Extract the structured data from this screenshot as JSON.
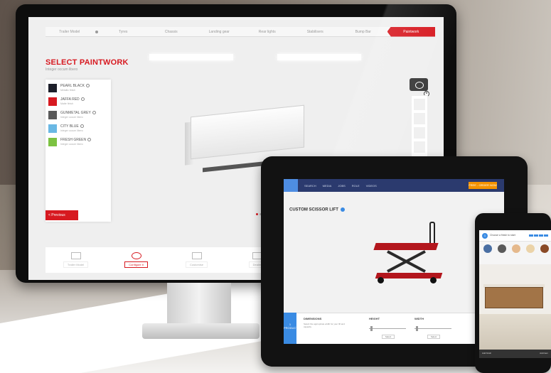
{
  "desktop": {
    "steps": [
      "Trailer Model",
      "Tyres",
      "Chassis",
      "Landing gear",
      "Rear lights",
      "Stabilisers",
      "Bump Bar",
      "Paintwork"
    ],
    "active_step": "Paintwork",
    "title": "SELECT PAINTWORK",
    "subtitle": "Integer occum libero",
    "swatches": [
      {
        "name": "PEARL BLACK",
        "desc": "Metallic finish",
        "color": "#1d1f2a"
      },
      {
        "name": "JAFFA RED",
        "desc": "Matte finish",
        "color": "#d71920"
      },
      {
        "name": "GUNMETAL GREY",
        "desc": "Integer occum libero",
        "color": "#5a5a5a"
      },
      {
        "name": "CITY BLUE",
        "desc": "Integer occum libero",
        "color": "#6ab8e4"
      },
      {
        "name": "FRESH GREEN",
        "desc": "Integer occum libero",
        "color": "#7cc242"
      }
    ],
    "previous_label": "< Previous",
    "bottom_nav": [
      "Trailer Model",
      "Configure it",
      "Customise",
      "Dealer"
    ],
    "bottom_nav_active": "Configure it"
  },
  "tablet": {
    "tabs": [
      "SEARCH",
      "MEDIA",
      "JOBS",
      "ROLE",
      "VIDEOS"
    ],
    "cta_label": "FREE - ORDER NOW",
    "product_title": "CUSTOM SCISSOR LIFT",
    "side_button": "1 PRODUCT",
    "dimensions_label": "DIMENSIONS",
    "dimensions_desc": "Select the appropriate width for your lift and capacity",
    "height_label": "HEIGHT",
    "width_label": "WIDTH",
    "height_button": "Select",
    "width_button": "Select"
  },
  "phone": {
    "step_number": "1",
    "step_label": "Choose a finish to start",
    "colors": [
      "#4a6fa3",
      "#5a5a5a",
      "#e5b98c",
      "#ebd3a8",
      "#8a4a26"
    ],
    "bottom_left": "Add finish",
    "bottom_right": "Add item"
  },
  "colors": {
    "brand_red": "#d71920",
    "tablet_blue": "#2b3a6e",
    "accent_orange": "#f39200"
  }
}
